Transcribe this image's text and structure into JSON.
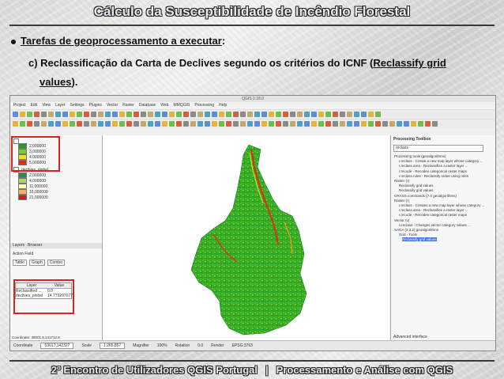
{
  "slide": {
    "title": "Cálculo da Susceptibilidade de Incêndio Florestal",
    "bullet": {
      "prefix": "Tarefas de geoprocessamento a executar",
      "suffix": ":"
    },
    "item": {
      "line_a": "c) Reclassificação da Carta de Declives segundo os critérios do ICNF (",
      "link_a": "Reclassify grid",
      "link_b": "values",
      "tail": ")."
    },
    "footer": {
      "left": "2º Encontro de Utilizadores QGIS Portugal",
      "sep": "|",
      "right": "Processamento e Análise com QGIS"
    }
  },
  "qgis": {
    "window_title": "QGIS 2.18.0",
    "menu": [
      "Project",
      "Edit",
      "View",
      "Layer",
      "Settings",
      "Plugins",
      "Vector",
      "Raster",
      "Database",
      "Web",
      "MMQGIS",
      "Processing",
      "Help"
    ],
    "layers": {
      "group1_values": [
        "2,000000",
        "3,000000",
        "4,000000",
        "5,000000"
      ],
      "group1_colors": [
        "#1f9e27",
        "#7ccf1a",
        "#f2e018",
        "#e62a1a"
      ],
      "group2_name": "declives_pinhel",
      "group2_values": [
        "2,000000",
        "4,000000",
        "11,000000",
        "16,000000",
        "21,000000"
      ],
      "group2_colors": [
        "#1a9641",
        "#a6d96a",
        "#ffffbf",
        "#fdae61",
        "#d7191c"
      ]
    },
    "panel_tabs": [
      "Layers",
      "Browser"
    ],
    "action_panel": {
      "title": "Action Field",
      "tabs": [
        "Table",
        "Graph",
        "Combo"
      ],
      "table_headers": [
        "Layer",
        "Value"
      ],
      "rows": [
        {
          "layer": "Reclassified ...",
          "value": "0.0"
        },
        {
          "layer": "declives_pinhel",
          "value": "14.7732070771"
        }
      ]
    },
    "toolbox": {
      "title": "Processing Toolbox",
      "search": "reclass",
      "items": [
        "Processing tools (geoalgorithms)",
        "r.reclass - Create a new map layer whose category ...",
        "r.reclass.area - Reclassifies a raster layer ...",
        "r.recode - Recodes categorical raster maps",
        "r.reclass.rules - Reclassify raster using rules",
        "Raster (r)",
        "Reclassify grid values",
        "Reclassify grid values",
        "GRASS commands (7.0 geoalgorithms)",
        "Raster (r)",
        "r.reclass - Creates a new map layer whose category ...",
        "r.reclass.area - Reclassifies a raster layer ...",
        "r.recode - Recodes categorical raster maps",
        "Vector (v)",
        "v.reclass - Changes vector category values ...",
        "SAGA (2.3.2) geoalgorithms",
        "Grid - Tools",
        "Reclassify grid values"
      ],
      "footer": "Advanced interface"
    },
    "status": {
      "coord_label": "Coordinate",
      "coord": "53017,142327",
      "scale_label": "Scale",
      "scale": "1:265,857",
      "magnifier_label": "Magnifier",
      "magnifier": "100%",
      "rotation_label": "Rotation",
      "rotation": "0.0",
      "render_label": "Render",
      "epsg": "EPSG:3763"
    },
    "left_coord": "Coordinate: 38501.9,141712.8"
  }
}
